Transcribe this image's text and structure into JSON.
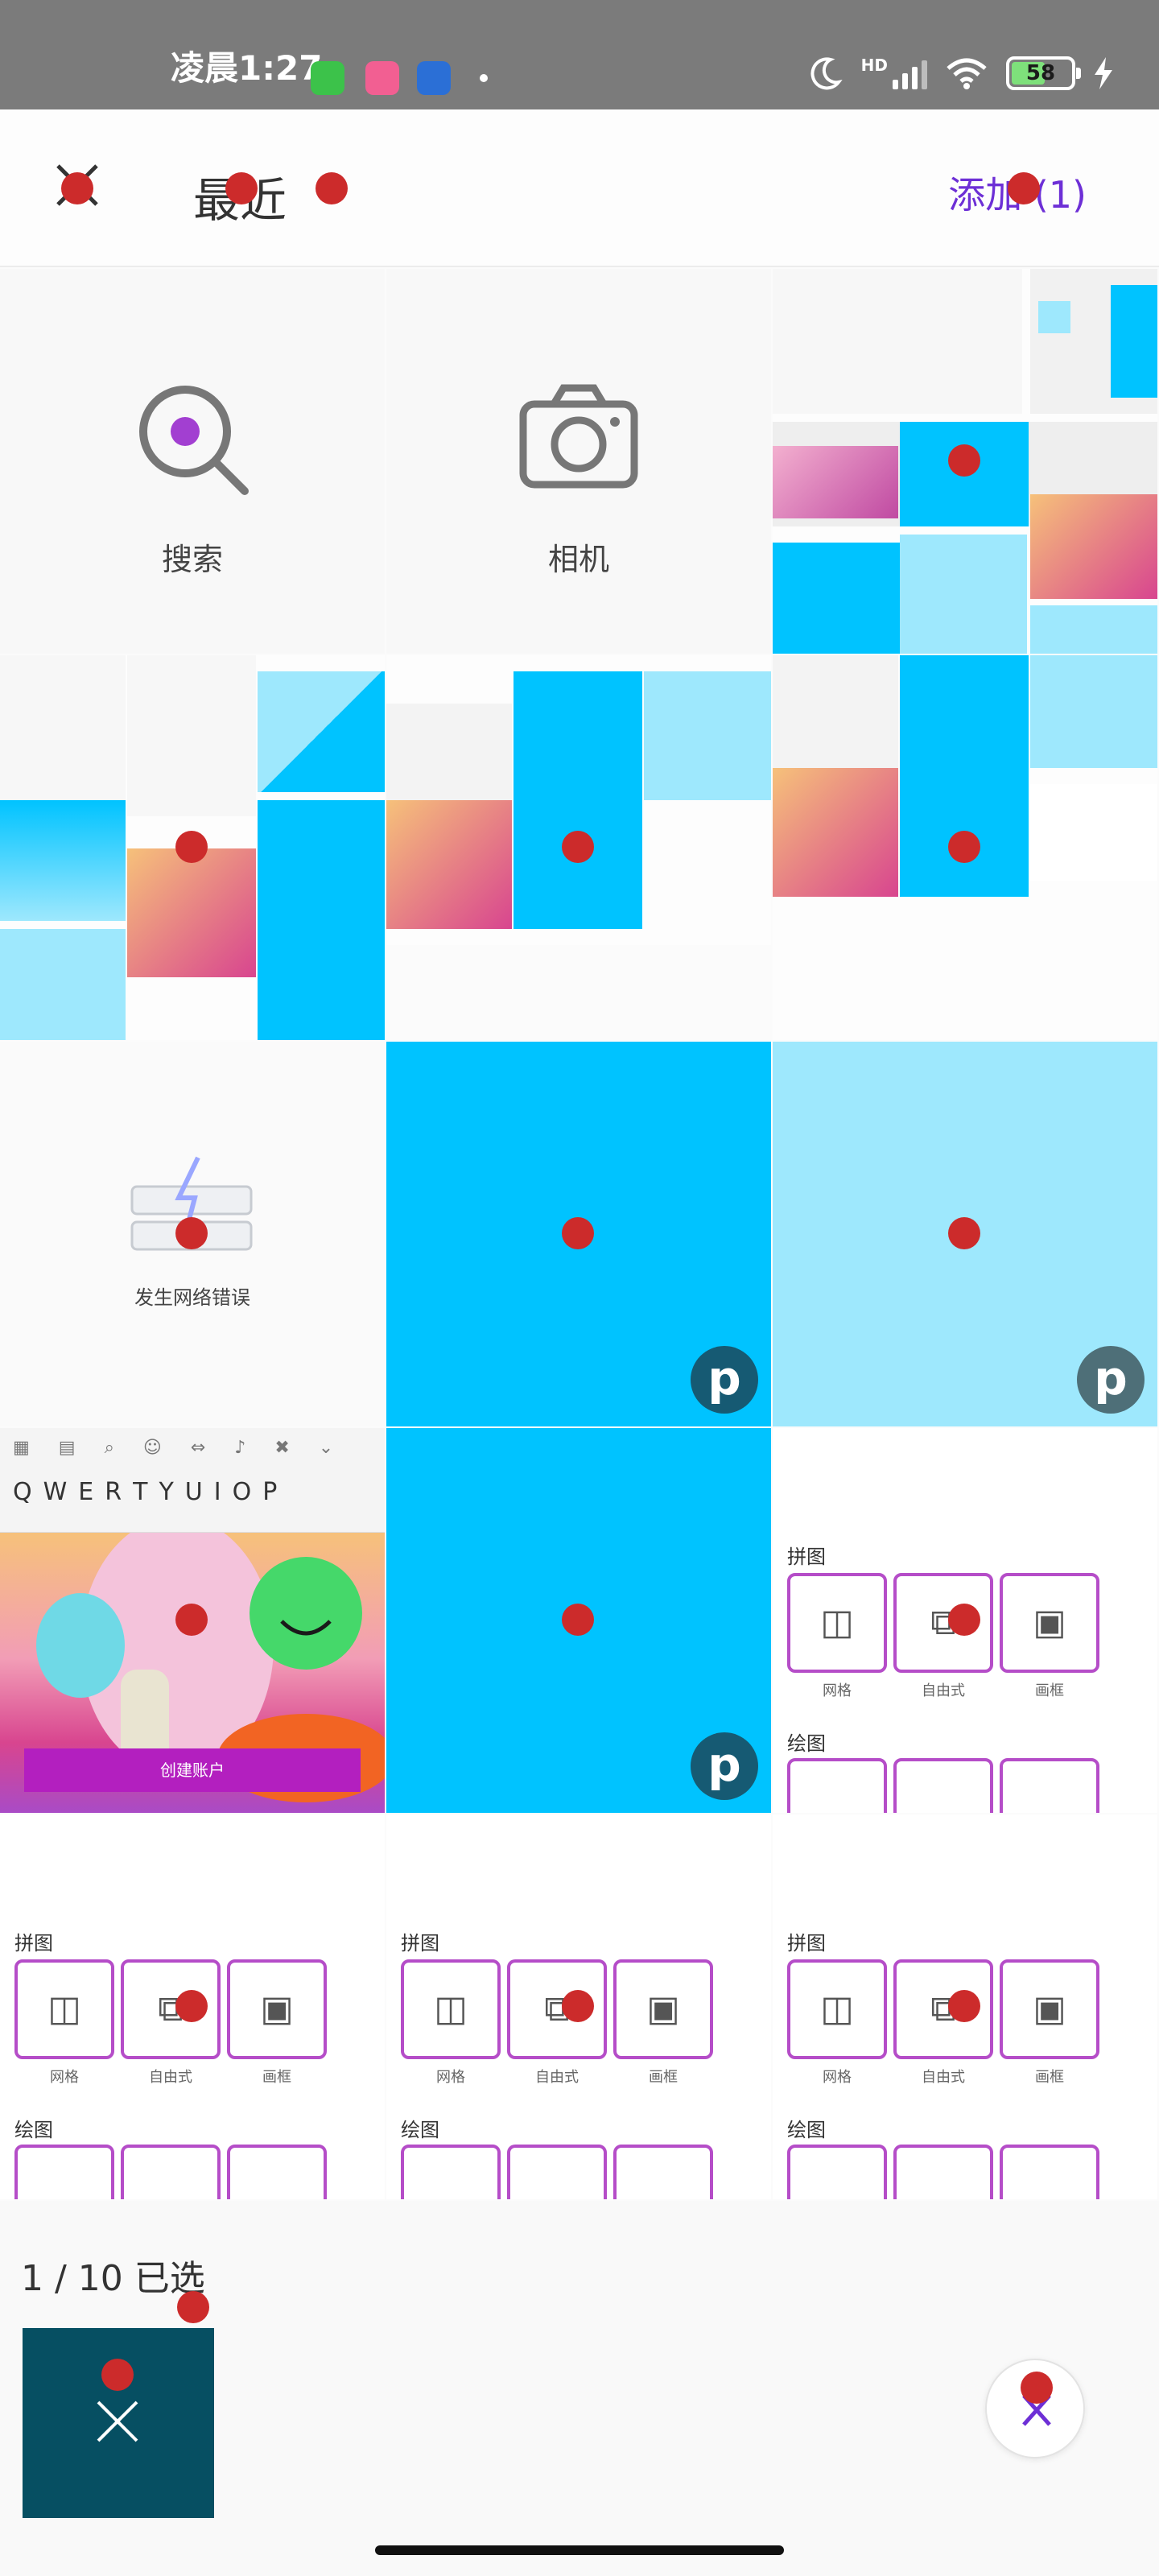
{
  "status_bar": {
    "time": "凌晨1:27",
    "network": "HD",
    "battery": "58",
    "app_icons": [
      "wechat-style-app-icon",
      "bilibili-icon",
      "browser-app-icon"
    ]
  },
  "header": {
    "close_label": "close",
    "title": "最近",
    "add_label": "添加 (1)"
  },
  "grid": {
    "search_label": "搜索",
    "camera_label": "相机",
    "error_label": "发生网络错误",
    "create_account_label": "创建账户",
    "keyboard_keys": [
      "Q",
      "W",
      "E",
      "R",
      "T",
      "Y",
      "U",
      "I",
      "O",
      "P"
    ],
    "collage": {
      "section_pintu": "拼图",
      "section_huitu": "绘图",
      "grid_label": "网格",
      "free_label": "自由式",
      "frame_label": "画框"
    },
    "badge_letter": "p"
  },
  "bottom": {
    "selected_count": "1 / 10 已选"
  },
  "colors": {
    "accent": "#6d2fd6",
    "marker": "#cc2b2b",
    "bright_blue": "#00c3ff",
    "light_blue": "#9ee8fd",
    "badge": "#165a73",
    "selected_thumb": "#064f62"
  }
}
